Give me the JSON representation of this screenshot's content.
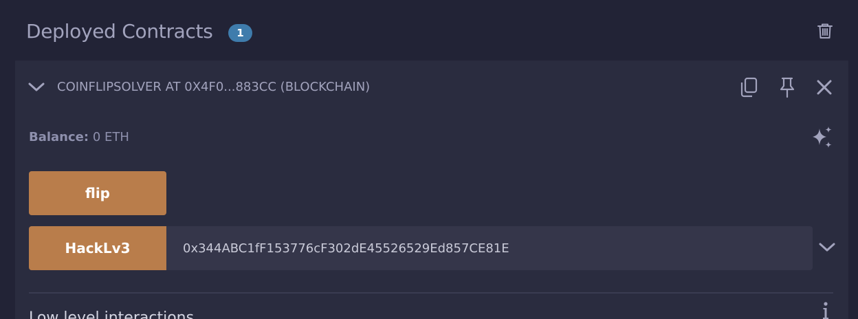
{
  "header": {
    "title": "Deployed Contracts",
    "count": "1",
    "trash_icon": "trash-icon"
  },
  "contract": {
    "name": "COINFLIPSOLVER AT 0X4F0...883CC (BLOCKCHAIN)",
    "icons": [
      "chevron-down-icon",
      "copy-icon",
      "pin-icon",
      "close-icon"
    ],
    "balance_label": "Balance:",
    "balance_value": "0 ETH",
    "sparkle_icon": "sparkle-icon",
    "functions": [
      {
        "label": "flip"
      },
      {
        "label": "HackLv3",
        "input_value": "0x344ABC1fF153776cF302dE45526529Ed857CE81E"
      }
    ]
  },
  "low_level": {
    "title": "Low level interactions",
    "info_icon": "info-icon"
  },
  "colors": {
    "background": "#222336",
    "card": "#2a2c3f",
    "badge": "#3f7cac",
    "function_button": "#b97d4b",
    "input": "#35364a",
    "text": "#a2a3bd"
  }
}
